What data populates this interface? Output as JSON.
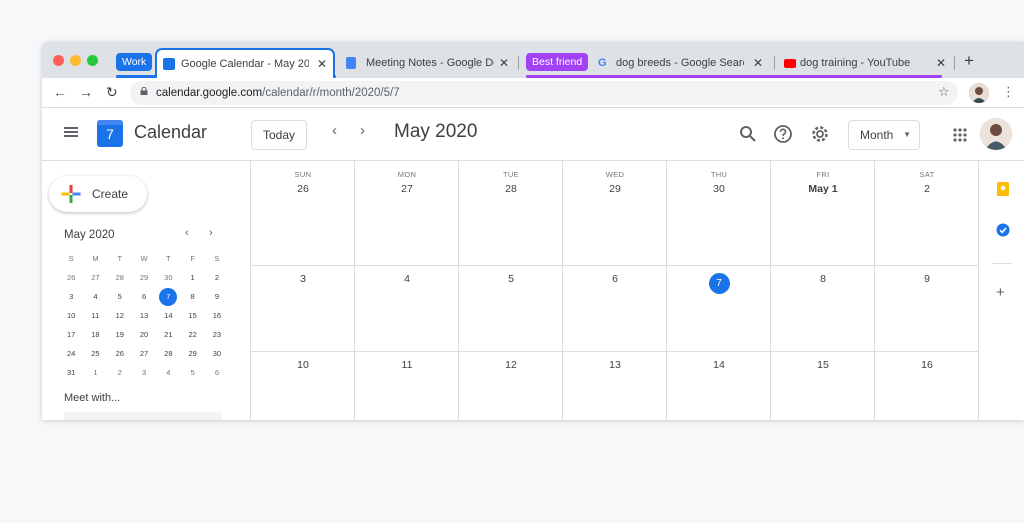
{
  "browser": {
    "tab_groups": [
      {
        "label": "Work",
        "color": "#1a73e8"
      },
      {
        "label": "Best friend",
        "color": "#a142f4"
      }
    ],
    "tabs": [
      {
        "title": "Google Calendar - May 20",
        "favicon": "calendar-icon",
        "active": true
      },
      {
        "title": "Meeting Notes - Google Do",
        "favicon": "docs-icon",
        "active": false
      },
      {
        "title": "dog breeds - Google Searc",
        "favicon": "google-icon",
        "active": false
      },
      {
        "title": "dog training - YouTube",
        "favicon": "youtube-icon",
        "active": false
      }
    ],
    "new_tab": "+",
    "close_glyph": "✕",
    "address": {
      "host": "calendar.google.com",
      "path": "/calendar/r/month/2020/5/7"
    },
    "nav": {
      "back": "←",
      "forward": "→",
      "reload": "↻"
    },
    "bookmark_glyph": "☆",
    "menu_glyph": "⋮"
  },
  "calendar": {
    "app_name": "Calendar",
    "logo_day": "7",
    "today_button": "Today",
    "prev": "‹",
    "next": "›",
    "period": "May 2020",
    "view_select": "Month",
    "create_label": "Create",
    "mini": {
      "title": "May 2020",
      "weekdays": [
        "S",
        "M",
        "T",
        "W",
        "T",
        "F",
        "S"
      ],
      "weeks": [
        [
          "26",
          "27",
          "28",
          "29",
          "30",
          "1",
          "2"
        ],
        [
          "3",
          "4",
          "5",
          "6",
          "7",
          "8",
          "9"
        ],
        [
          "10",
          "11",
          "12",
          "13",
          "14",
          "15",
          "16"
        ],
        [
          "17",
          "18",
          "19",
          "20",
          "21",
          "22",
          "23"
        ],
        [
          "24",
          "25",
          "26",
          "27",
          "28",
          "29",
          "30"
        ],
        [
          "31",
          "1",
          "2",
          "3",
          "4",
          "5",
          "6"
        ]
      ],
      "selected": "7"
    },
    "meet_with": "Meet with...",
    "month": {
      "weekdays": [
        "SUN",
        "MON",
        "TUE",
        "WED",
        "THU",
        "FRI",
        "SAT"
      ],
      "rows": [
        [
          "26",
          "27",
          "28",
          "29",
          "30",
          "May 1",
          "2"
        ],
        [
          "3",
          "4",
          "5",
          "6",
          "7",
          "8",
          "9"
        ],
        [
          "10",
          "11",
          "12",
          "13",
          "14",
          "15",
          "16"
        ]
      ],
      "today": "7"
    },
    "side_panel_plus": "+"
  }
}
